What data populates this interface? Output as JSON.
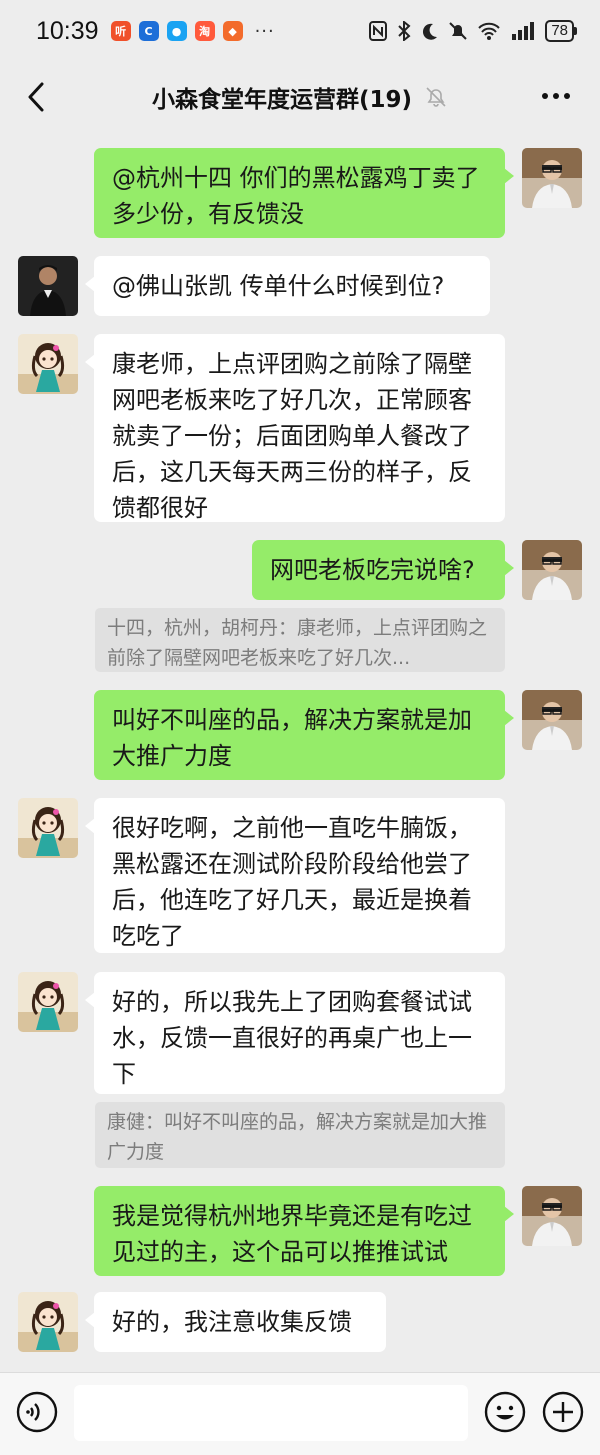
{
  "status_bar": {
    "time": "10:39",
    "battery": "78"
  },
  "header": {
    "title": "小森食堂年度运营群(19)"
  },
  "messages": [
    {
      "side": "right",
      "sender": "me",
      "text": "@杭州十四  你们的黑松露鸡丁卖了多少份，有反馈没"
    },
    {
      "side": "left",
      "sender": "man",
      "text": "@佛山张凯  传单什么时候到位?"
    },
    {
      "side": "left",
      "sender": "girl",
      "text": "康老师，上点评团购之前除了隔壁网吧老板来吃了好几次，正常顾客就卖了一份；后面团购单人餐改了后，这几天每天两三份的样子，反馈都很好"
    },
    {
      "side": "right",
      "sender": "me",
      "text": "网吧老板吃完说啥?",
      "quote": "十四，杭州，胡柯丹：康老师，上点评团购之前除了隔壁网吧老板来吃了好几次..."
    },
    {
      "side": "right",
      "sender": "me",
      "text": "叫好不叫座的品，解决方案就是加大推广力度"
    },
    {
      "side": "left",
      "sender": "girl",
      "text": "很好吃啊，之前他一直吃牛腩饭，黑松露还在测试阶段阶段给他尝了后，他连吃了好几天，最近是换着吃吃了"
    },
    {
      "side": "left",
      "sender": "girl",
      "text": "好的，所以我先上了团购套餐试试水，反馈一直很好的再桌广也上一下",
      "quote": "康健：叫好不叫座的品，解决方案就是加大推广力度"
    },
    {
      "side": "right",
      "sender": "me",
      "text": "我是觉得杭州地界毕竟还是有吃过见过的主，这个品可以推推试试"
    },
    {
      "side": "left",
      "sender": "girl",
      "text": "好的，我注意收集反馈"
    }
  ],
  "colors": {
    "background": "#ededed",
    "bubble_right": "#95ec69",
    "bubble_left": "#ffffff",
    "quote_bg": "#e0e0e0"
  },
  "icons": {
    "back": "back-chevron-icon",
    "mute": "mute-bell-icon",
    "more": "more-dots-icon",
    "voice": "voice-icon",
    "emoji": "emoji-icon",
    "plus": "plus-icon"
  }
}
